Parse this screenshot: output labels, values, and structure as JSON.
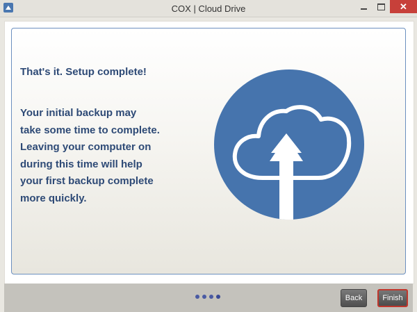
{
  "window": {
    "title": "COX | Cloud Drive",
    "icon": "upload-app-icon",
    "controls": {
      "minimize": "–",
      "maximize": "□",
      "close": "✕"
    }
  },
  "content": {
    "heading": "That's it. Setup complete!",
    "message_lines": [
      "Your initial backup may",
      "take some time to complete.",
      "Leaving your computer on",
      "during this time will help",
      "your first backup complete",
      "more quickly."
    ],
    "illustration": "cloud-upload-icon",
    "illustration_color": "#4674ad"
  },
  "footer": {
    "step_indicator": {
      "total": 4,
      "current": 4
    },
    "back_label": "Back",
    "finish_label": "Finish"
  }
}
